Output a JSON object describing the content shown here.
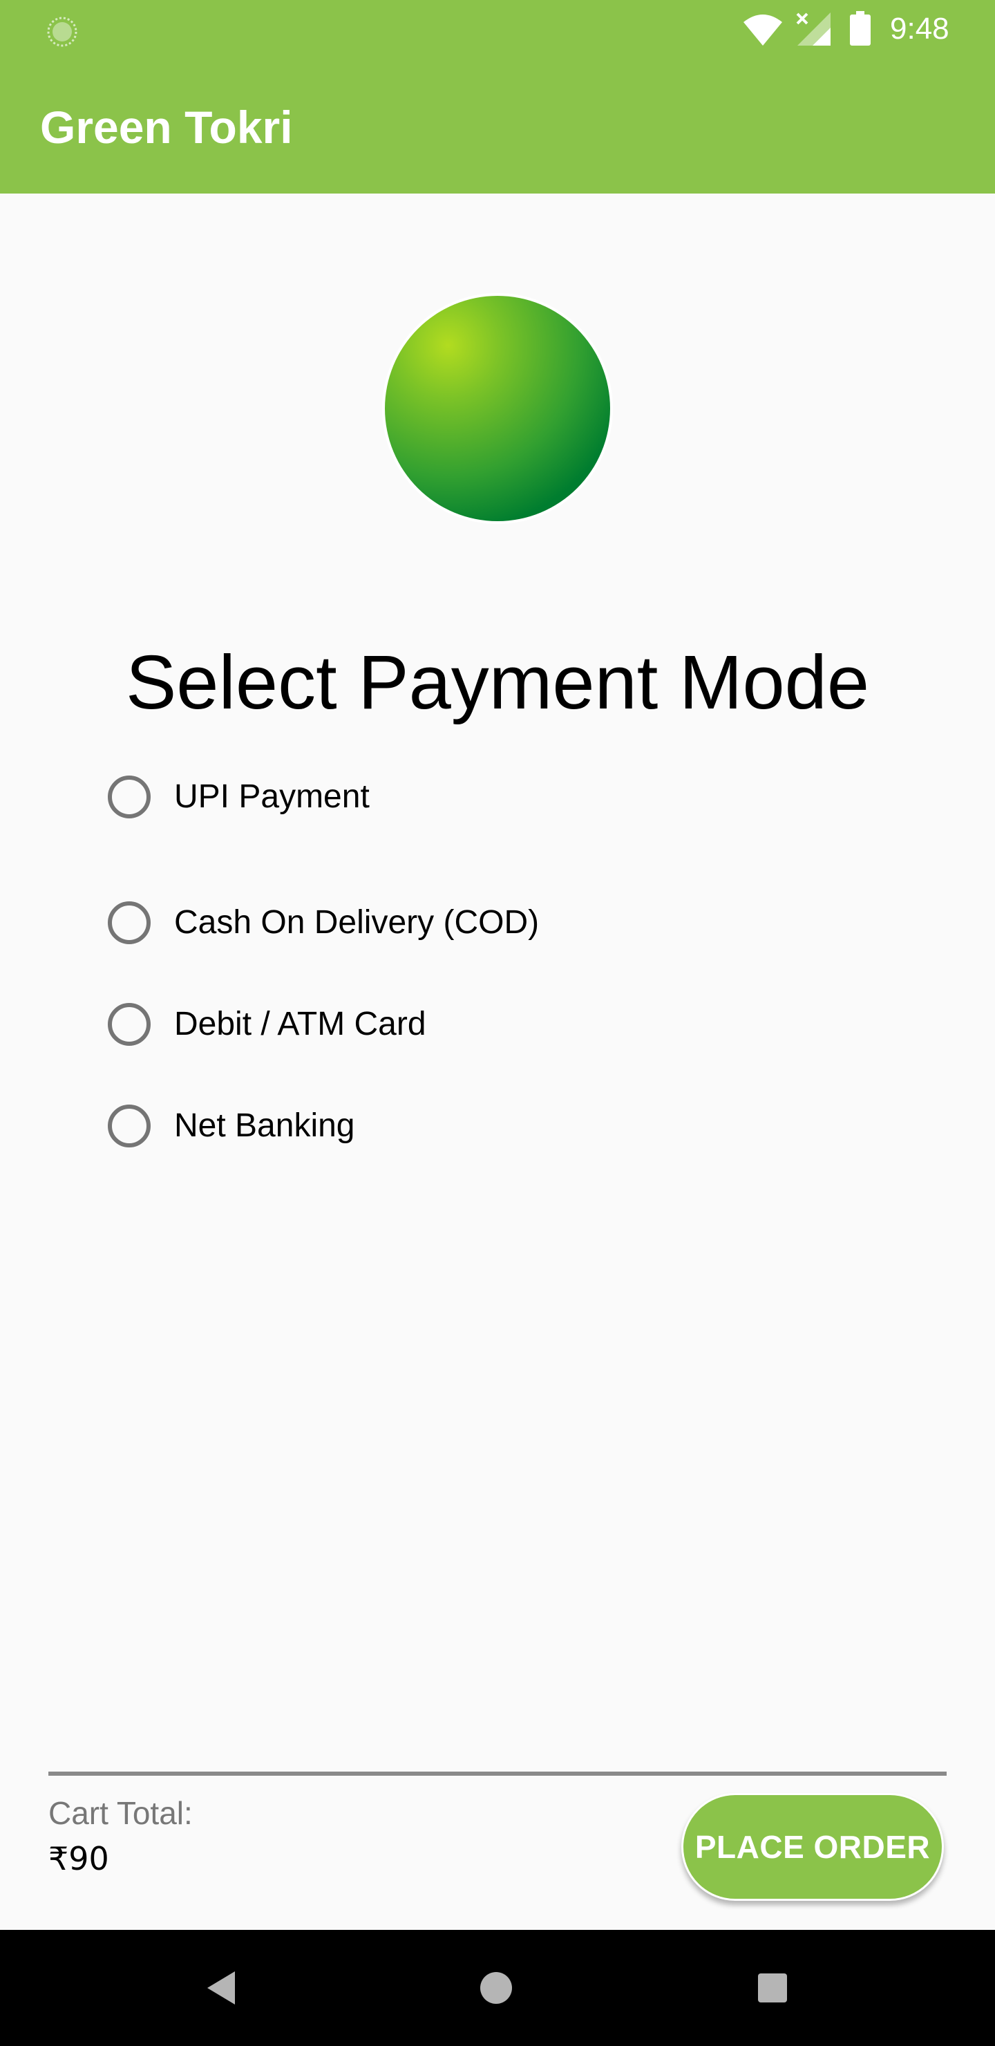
{
  "status_bar": {
    "time": "9:48",
    "icons": [
      "sync-circle-icon",
      "wifi-icon",
      "cellular-no-signal-icon",
      "battery-icon"
    ]
  },
  "app_bar": {
    "title": "Green Tokri"
  },
  "logo": {
    "icon": "green-orb-logo"
  },
  "payment": {
    "heading": "Select Payment Mode",
    "options": [
      {
        "label": "UPI Payment",
        "selected": false
      },
      {
        "label": "Cash On Delivery (COD)",
        "selected": false
      },
      {
        "label": "Debit / ATM Card",
        "selected": false
      },
      {
        "label": "Net Banking",
        "selected": false
      }
    ]
  },
  "footer": {
    "total_label": "Cart Total:",
    "total_value": "₹90",
    "place_order_label": "PLACE ORDER"
  },
  "nav_bar": {
    "icons": [
      "back-icon",
      "home-icon",
      "recents-icon"
    ]
  },
  "colors": {
    "primary": "#8bc34a",
    "radio_border": "#757575",
    "muted_text": "#777777"
  }
}
